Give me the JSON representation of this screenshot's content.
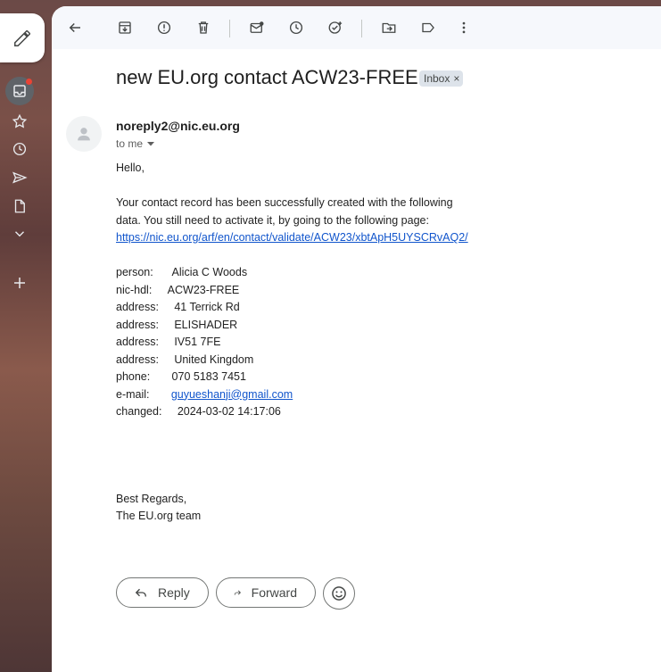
{
  "toolbar": {
    "icons": [
      "back-icon",
      "archive-icon",
      "report-spam-icon",
      "delete-icon",
      "mark-unread-icon",
      "snooze-icon",
      "add-to-tasks-icon",
      "move-to-icon",
      "label-icon",
      "more-icon"
    ]
  },
  "message": {
    "subject": "new EU.org contact ACW23-FREE",
    "label_badge": "Inbox",
    "label_close": "×",
    "sender": "noreply2@nic.eu.org",
    "recipient": "to me",
    "greeting": "Hello,",
    "intro_line1": "Your contact record has been successfully created with the following",
    "intro_line2": "data. You still need to activate it, by going to the following page:",
    "validate_link": "https://nic.eu.org/arf/en/contact/validate/ACW23/xbtApH5UYSCRvAQ2/",
    "fields": [
      {
        "key": "person:",
        "pad": "      ",
        "value": "Alicia C Woods"
      },
      {
        "key": "nic-hdl:",
        "pad": "     ",
        "value": "ACW23-FREE"
      },
      {
        "key": "address:",
        "pad": "     ",
        "value": "41 Terrick Rd"
      },
      {
        "key": "address:",
        "pad": "     ",
        "value": "ELISHADER"
      },
      {
        "key": "address:",
        "pad": "     ",
        "value": "IV51 7FE"
      },
      {
        "key": "address:",
        "pad": "     ",
        "value": "United Kingdom"
      },
      {
        "key": "phone:",
        "pad": "       ",
        "value": "070 5183 7451"
      },
      {
        "key": "e-mail:",
        "pad": "       ",
        "value": "guyueshanji@gmail.com"
      },
      {
        "key": "changed:",
        "pad": "     ",
        "value": "2024-03-02 14:17:06"
      }
    ],
    "closing1": "Best Regards,",
    "closing2": "The EU.org team"
  },
  "actions": {
    "reply": "Reply",
    "forward": "Forward"
  }
}
